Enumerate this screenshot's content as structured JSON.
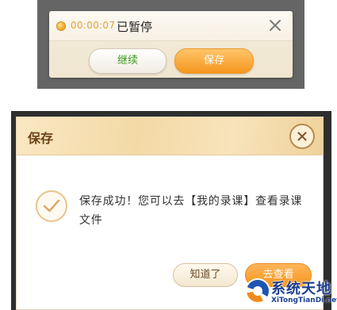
{
  "colors": {
    "accent_orange": "#f5961e",
    "accent_gold": "#e8a21c",
    "timer_color": "#e3a23b",
    "continue_color": "#3f9a22",
    "watermark_color": "#1c3f8f"
  },
  "pause_dialog": {
    "timer": "00:00:07",
    "status": "已暂停",
    "continue_label": "继续",
    "save_label": "保存"
  },
  "save_dialog": {
    "title": "保存",
    "message": "保存成功！您可以去【我的录课】查看录课文件",
    "ok_label": "知道了",
    "view_label": "去查看"
  },
  "watermark": {
    "name": "系统天地",
    "url": "XiTongTianDi.net"
  },
  "icons": {
    "record": "record-indicator-icon",
    "close": "close-icon",
    "success": "check-circle-icon",
    "logo": "site-logo-icon"
  }
}
